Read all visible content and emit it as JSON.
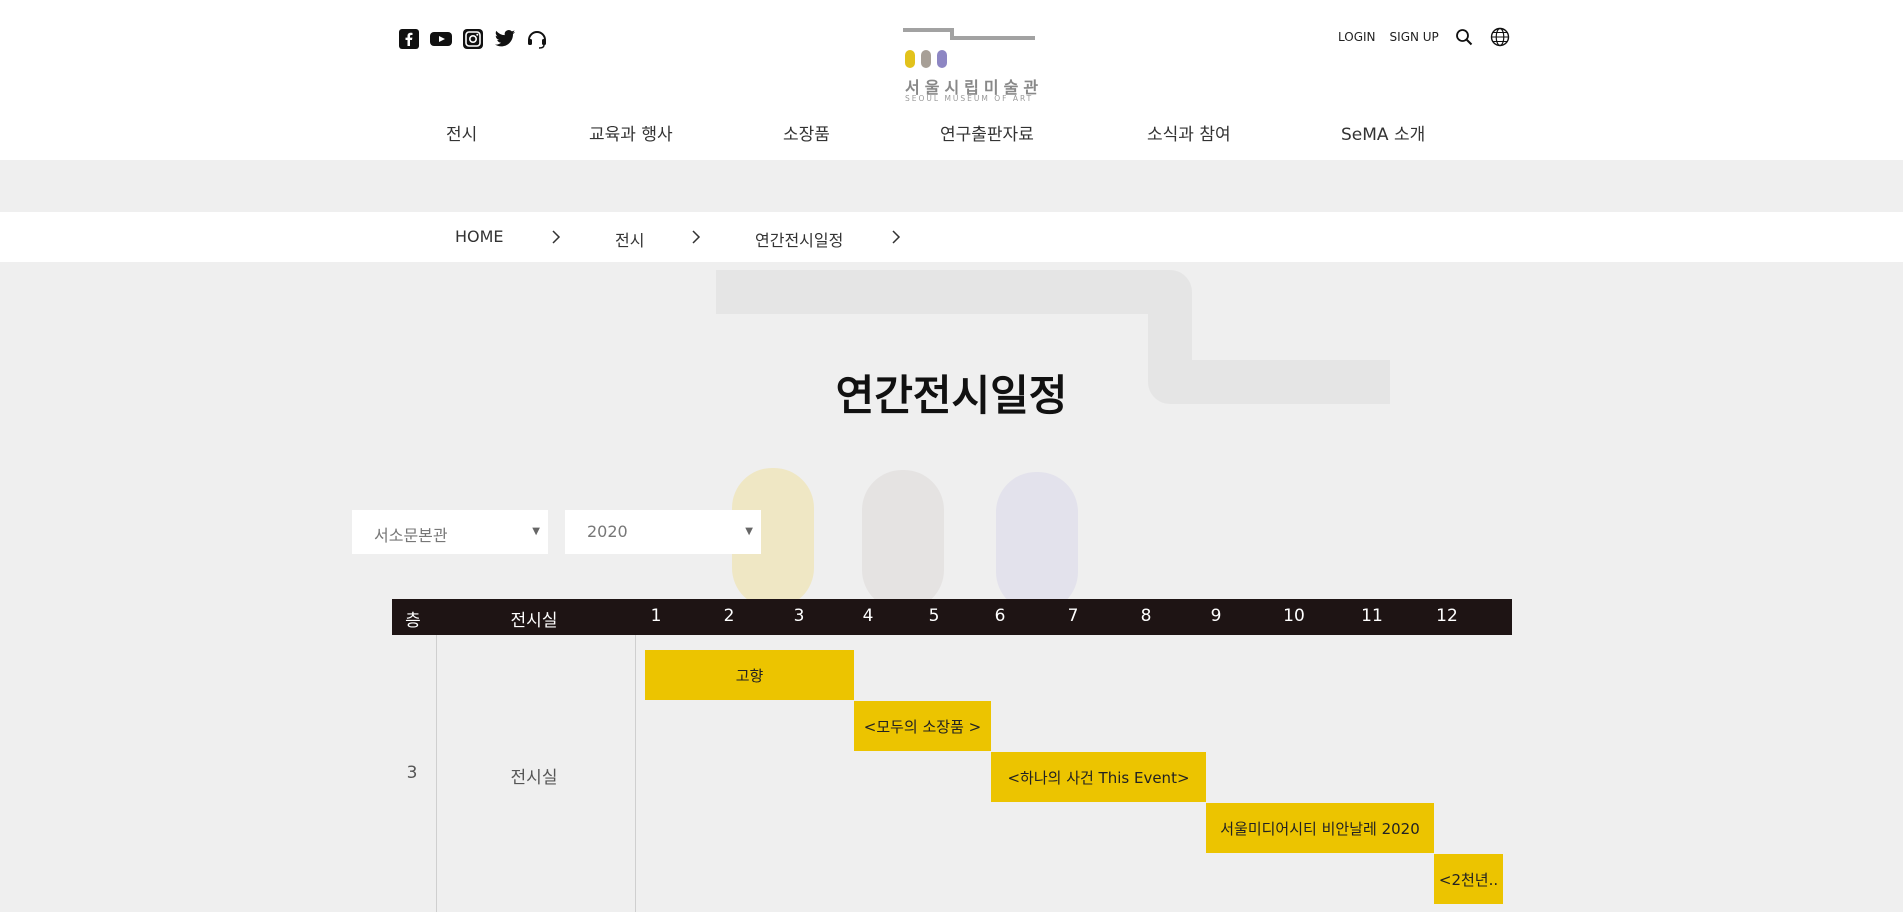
{
  "header": {
    "social_icons": [
      "facebook-icon",
      "youtube-icon",
      "instagram-icon",
      "twitter-icon",
      "headset-icon"
    ],
    "logo_text": "서울시립미술관",
    "logo_sub": "SEOUL MUSEUM OF ART",
    "logo_colors": [
      "#e2c21b",
      "#a79f96",
      "#8d86c3"
    ],
    "login": "LOGIN",
    "signup": "SIGN UP"
  },
  "nav": {
    "items": [
      {
        "label": "전시"
      },
      {
        "label": "교육과 행사"
      },
      {
        "label": "소장품"
      },
      {
        "label": "연구출판자료"
      },
      {
        "label": "소식과 참여"
      },
      {
        "label": "SeMA 소개"
      }
    ]
  },
  "breadcrumb": {
    "items": [
      {
        "label": "HOME"
      },
      {
        "label": "전시"
      },
      {
        "label": "연간전시일정"
      }
    ]
  },
  "page": {
    "title": "연간전시일정"
  },
  "filters": {
    "venue": "서소문본관",
    "year": "2020"
  },
  "schedule": {
    "headers": {
      "floor": "층",
      "room": "전시실",
      "months": [
        "1",
        "2",
        "3",
        "4",
        "5",
        "6",
        "7",
        "8",
        "9",
        "10",
        "11",
        "12"
      ]
    },
    "floor": "3",
    "room": "전시실",
    "exhibitions": [
      {
        "title": "고향"
      },
      {
        "title": "<모두의 소장품 >"
      },
      {
        "title": "<하나의 사건 This Event>"
      },
      {
        "title": "서울미디어시티 비안날레 2020"
      },
      {
        "title": "<2천년.."
      }
    ]
  },
  "colors": {
    "accent_yellow": "#ecc400",
    "table_header": "#1e1414"
  }
}
